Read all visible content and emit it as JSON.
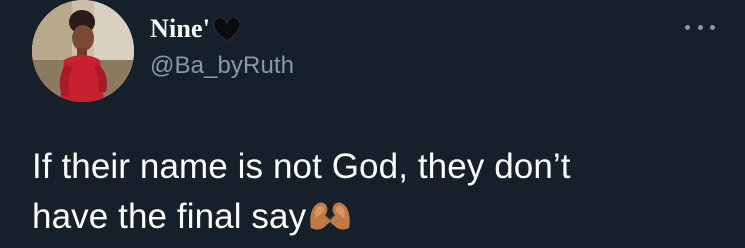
{
  "author": {
    "display_name": "Nine'",
    "name_emoji": "black-heart-icon",
    "handle": "@Ba_byRuth"
  },
  "tweet": {
    "line1": "If their name is not God, they don’t",
    "line2": "have the final say",
    "trailing_emoji": "heart-hands-emoji"
  },
  "menu": {
    "icon": "more-options-icon"
  },
  "colors": {
    "background": "#15202b",
    "text": "#ffffff",
    "secondary_text": "#8899a6"
  }
}
